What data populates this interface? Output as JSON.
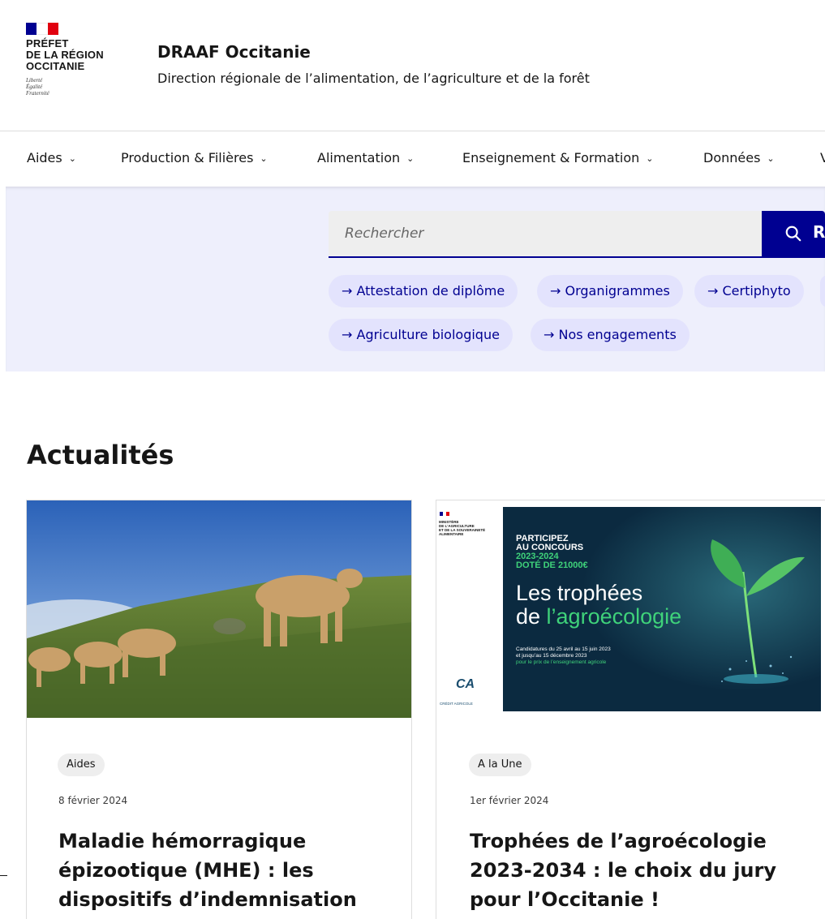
{
  "header": {
    "logo": {
      "lines": [
        "PRÉFET",
        "DE LA RÉGION",
        "OCCITANIE"
      ],
      "motto": [
        "Liberté",
        "Égalité",
        "Fraternité"
      ]
    },
    "site_title": "DRAAF Occitanie",
    "tagline": "Direction régionale de l’alimentation, de l’agriculture et de la forêt"
  },
  "nav": {
    "items": [
      {
        "label": "Aides"
      },
      {
        "label": "Production & Filières"
      },
      {
        "label": "Alimentation"
      },
      {
        "label": "Enseignement & Formation"
      },
      {
        "label": "Données"
      },
      {
        "label": "V"
      }
    ],
    "chevron": "⌄"
  },
  "search": {
    "placeholder": "Rechercher",
    "button_label": "Rechercher",
    "quick_links": [
      {
        "label": "→ Attestation de diplôme"
      },
      {
        "label": "→ Organigrammes"
      },
      {
        "label": "→ Certiphyto"
      },
      {
        "label": "→ Agriculture biologique"
      },
      {
        "label": "→ Nos engagements"
      }
    ]
  },
  "news": {
    "title": "Actualités",
    "cards": [
      {
        "badge": "Aides",
        "date": "8 février 2024",
        "title_lines": [
          "Maladie hémorragique",
          "épizootique (MHE) : les",
          "dispositifs d’indemnisation"
        ]
      },
      {
        "badge": "A la Une",
        "date": "1er février 2024",
        "title_lines": [
          "Trophées de l’agroécologie",
          "2023-2034 : le choix du jury",
          "pour l’Occitanie !"
        ],
        "poster": {
          "ministry": [
            "MINISTÈRE",
            "DE L'AGRICULTURE",
            "ET DE LA SOUVERAINETÉ",
            "ALIMENTAIRE"
          ],
          "line1": "PARTICIPEZ",
          "line2": "AU CONCOURS",
          "line3": "2023-2024",
          "line4": "DOTÉ DE 21000€",
          "headline1": "Les trophées",
          "headline2a": "de ",
          "headline2b": "l’agroécologie",
          "dates1": "Candidatures du 25 avril au 15 juin 2023",
          "dates2": "et jusqu’au 15 décembre 2023",
          "dates3": "pour le prix de l’enseignement agricole",
          "sponsor": "CRÉDIT AGRICOLE"
        }
      }
    ]
  },
  "colors": {
    "primary": "#000091",
    "chip_bg": "#e3e3fd",
    "band_bg": "#eeeffc",
    "flag_red": "#e1000f"
  }
}
